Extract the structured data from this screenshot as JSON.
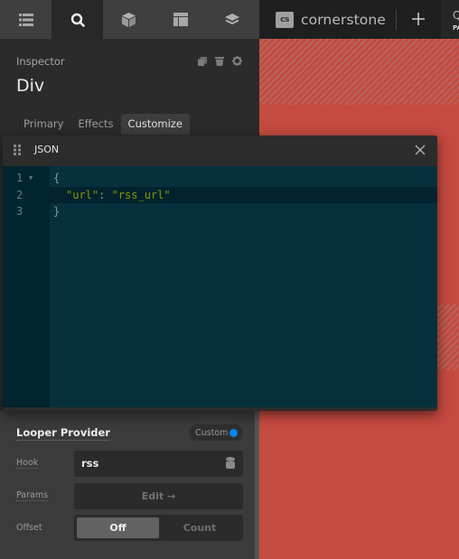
{
  "toolbar": {
    "tools": [
      {
        "name": "layers-list",
        "icon": "list-icon",
        "active": false
      },
      {
        "name": "search",
        "icon": "search-icon",
        "active": true
      },
      {
        "name": "elements",
        "icon": "cube-icon",
        "active": false
      },
      {
        "name": "templates",
        "icon": "layout-icon",
        "active": false
      },
      {
        "name": "stack",
        "icon": "stack-icon",
        "active": false
      }
    ]
  },
  "brand": {
    "logo_mark": "cs",
    "logo_text": "cornerstone",
    "add_icon": "plus-icon",
    "cut_letter": "Q",
    "cut_sub": "PA"
  },
  "inspector": {
    "label": "Inspector",
    "title": "Div",
    "actions": [
      "copy-icon",
      "delete-icon",
      "gear-icon"
    ],
    "tabs": [
      {
        "label": "Primary",
        "active": false
      },
      {
        "label": "Effects",
        "active": false
      },
      {
        "label": "Customize",
        "active": true
      }
    ]
  },
  "json_modal": {
    "title": "JSON",
    "lines": [
      {
        "num": "1",
        "text": "{",
        "foldable": true
      },
      {
        "num": "2",
        "key": "\"url\"",
        "sep": ": ",
        "value": "\"rss_url\"",
        "highlighted": true
      },
      {
        "num": "3",
        "text": "}"
      }
    ]
  },
  "looper": {
    "title": "Looper Provider",
    "badge": "Custom",
    "badge_color": "#0a84ea",
    "hook_label": "Hook",
    "hook_value": "rss",
    "params_label": "Params",
    "params_button": "Edit →",
    "offset_label": "Offset",
    "offset_options": [
      "Off",
      "Count"
    ],
    "offset_selected": "Off"
  },
  "colors": {
    "canvas": "#c54a3f",
    "editor_bg": "#07303d",
    "string": "#859900"
  }
}
